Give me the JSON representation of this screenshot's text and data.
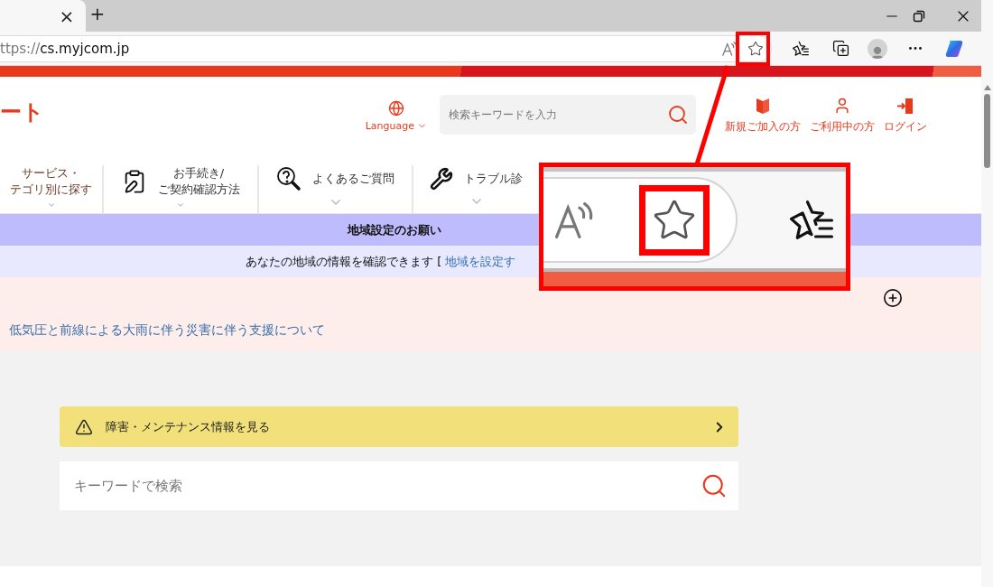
{
  "browser": {
    "tab_close": "×",
    "new_tab": "+",
    "url_scheme": "ttps://",
    "url_host": "cs.myjcom.jp"
  },
  "header": {
    "logo_text": "ート",
    "language": "Language",
    "search": {
      "placeholder": "検索キーワードを入力"
    },
    "links": [
      {
        "kind": "join",
        "label": "新規ご加入の方"
      },
      {
        "kind": "member",
        "label": "ご利用中の方"
      },
      {
        "kind": "login",
        "label": "ログイン"
      }
    ]
  },
  "nav": {
    "items": [
      {
        "kind": "plain",
        "lines": [
          "サービス・",
          "テゴリ別に探す"
        ]
      },
      {
        "kind": "procedure",
        "lines": [
          "お手続き/",
          "ご契約確認方法"
        ]
      },
      {
        "kind": "faq",
        "lines": [
          "よくあるご質問"
        ]
      },
      {
        "kind": "trouble",
        "lines": [
          "トラブル診"
        ]
      }
    ]
  },
  "region_notice": {
    "title": "地域設定のお願い",
    "message": "あなたの地域の情報を確認できます [",
    "link": "地域を設定す"
  },
  "announcement": {
    "expanded": false,
    "link": "低気圧と前線による大雨に伴う災害に伴う支援について"
  },
  "maintenance": {
    "label": "障害・メンテナンス情報を見る"
  },
  "keyword_search": {
    "placeholder": "キーワードで検索"
  }
}
